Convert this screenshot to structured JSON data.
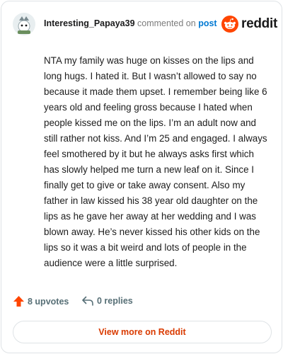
{
  "header": {
    "username": "Interesting_Papaya39",
    "commented_text": "commented on",
    "post_link": "post",
    "brand_wordmark": "reddit"
  },
  "comment": {
    "body": "NTA my family was huge on kisses on the lips and long hugs. I hated it. But I wasn’t allowed to say no because it made them upset. I remember being like 6 years old and feeling gross because I hated when people kissed me on the lips. I’m an adult now and still rather not kiss. And I’m 25 and engaged. I always feel smothered by it but he always asks first which has slowly helped me turn a new leaf on it. Since I finally get to give or take away consent. Also my father in law kissed his 38 year old daughter on the lips as he gave her away at her wedding and I was blown away. He’s never kissed his other kids on the lips so it was a bit weird and lots of people in the audience were a little surprised."
  },
  "footer": {
    "upvotes_label": "8 upvotes",
    "replies_label": "0 replies",
    "view_more_label": "View more on Reddit"
  },
  "icons": {
    "avatar": "snoo-avatar-icon",
    "brand": "reddit-snoo-icon",
    "upvote": "upvote-arrow-icon",
    "reply": "reply-arrow-icon"
  },
  "colors": {
    "brand_orange": "#ff4500",
    "link_blue": "#0079d3",
    "view_more_text": "#d93a00",
    "meta_gray": "#576f76"
  }
}
